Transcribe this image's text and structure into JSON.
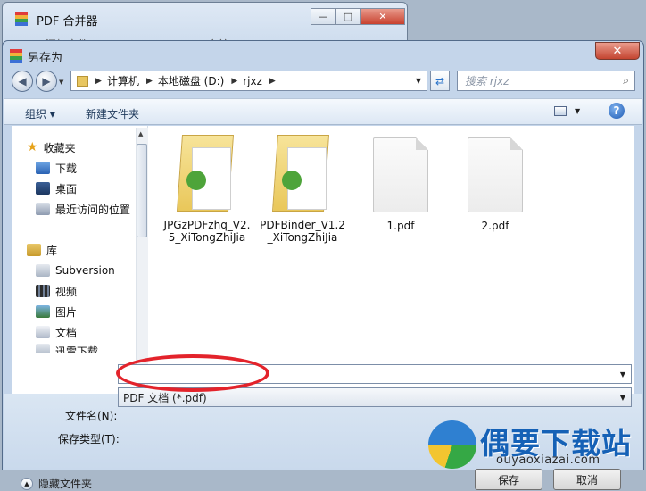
{
  "bg_window": {
    "title": "PDF 合并器",
    "toolbar_items": [
      "添加文件",
      "合并"
    ]
  },
  "dialog": {
    "title": "另存为",
    "close_symbol": "✕"
  },
  "address": {
    "segments": [
      "计算机",
      "本地磁盘 (D:)",
      "rjxz"
    ]
  },
  "search": {
    "placeholder": "搜索 rjxz"
  },
  "toolbar": {
    "organize": "组织 ▾",
    "new_folder": "新建文件夹",
    "help": "?"
  },
  "sidebar": {
    "favorites": {
      "label": "收藏夹",
      "items": [
        "下载",
        "桌面",
        "最近访问的位置"
      ]
    },
    "library": {
      "label": "库",
      "items": [
        "Subversion",
        "视频",
        "图片",
        "文档",
        "迅雷下载"
      ]
    }
  },
  "files": [
    {
      "name": "JPGzPDFzhq_V2.5_XiTongZhiJia",
      "line1": "JPGzPDFzhq_V2.",
      "line2": "5_XiTongZhiJia",
      "type": "folder"
    },
    {
      "name": "PDFBinder_V1.2_XiTongZhiJia",
      "line1": "PDFBinder_V1.2",
      "line2": "_XiTongZhiJia",
      "type": "folder"
    },
    {
      "name": "1.pdf",
      "line1": "1.pdf",
      "line2": "",
      "type": "pdf"
    },
    {
      "name": "2.pdf",
      "line1": "2.pdf",
      "line2": "",
      "type": "pdf"
    }
  ],
  "form": {
    "filename_label": "文件名(N):",
    "filename_value": "",
    "filetype_label": "保存类型(T):",
    "filetype_value": "PDF 文档 (*.pdf)"
  },
  "footer": {
    "hide_folders": "隐藏文件夹",
    "save": "保存",
    "cancel": "取消"
  },
  "watermark": {
    "text": "偶要下载站",
    "url": "ouyaoxiazai.com"
  },
  "colors": {
    "annotation_oval": "#e3232b",
    "watermark_blue": "#1561b6"
  }
}
